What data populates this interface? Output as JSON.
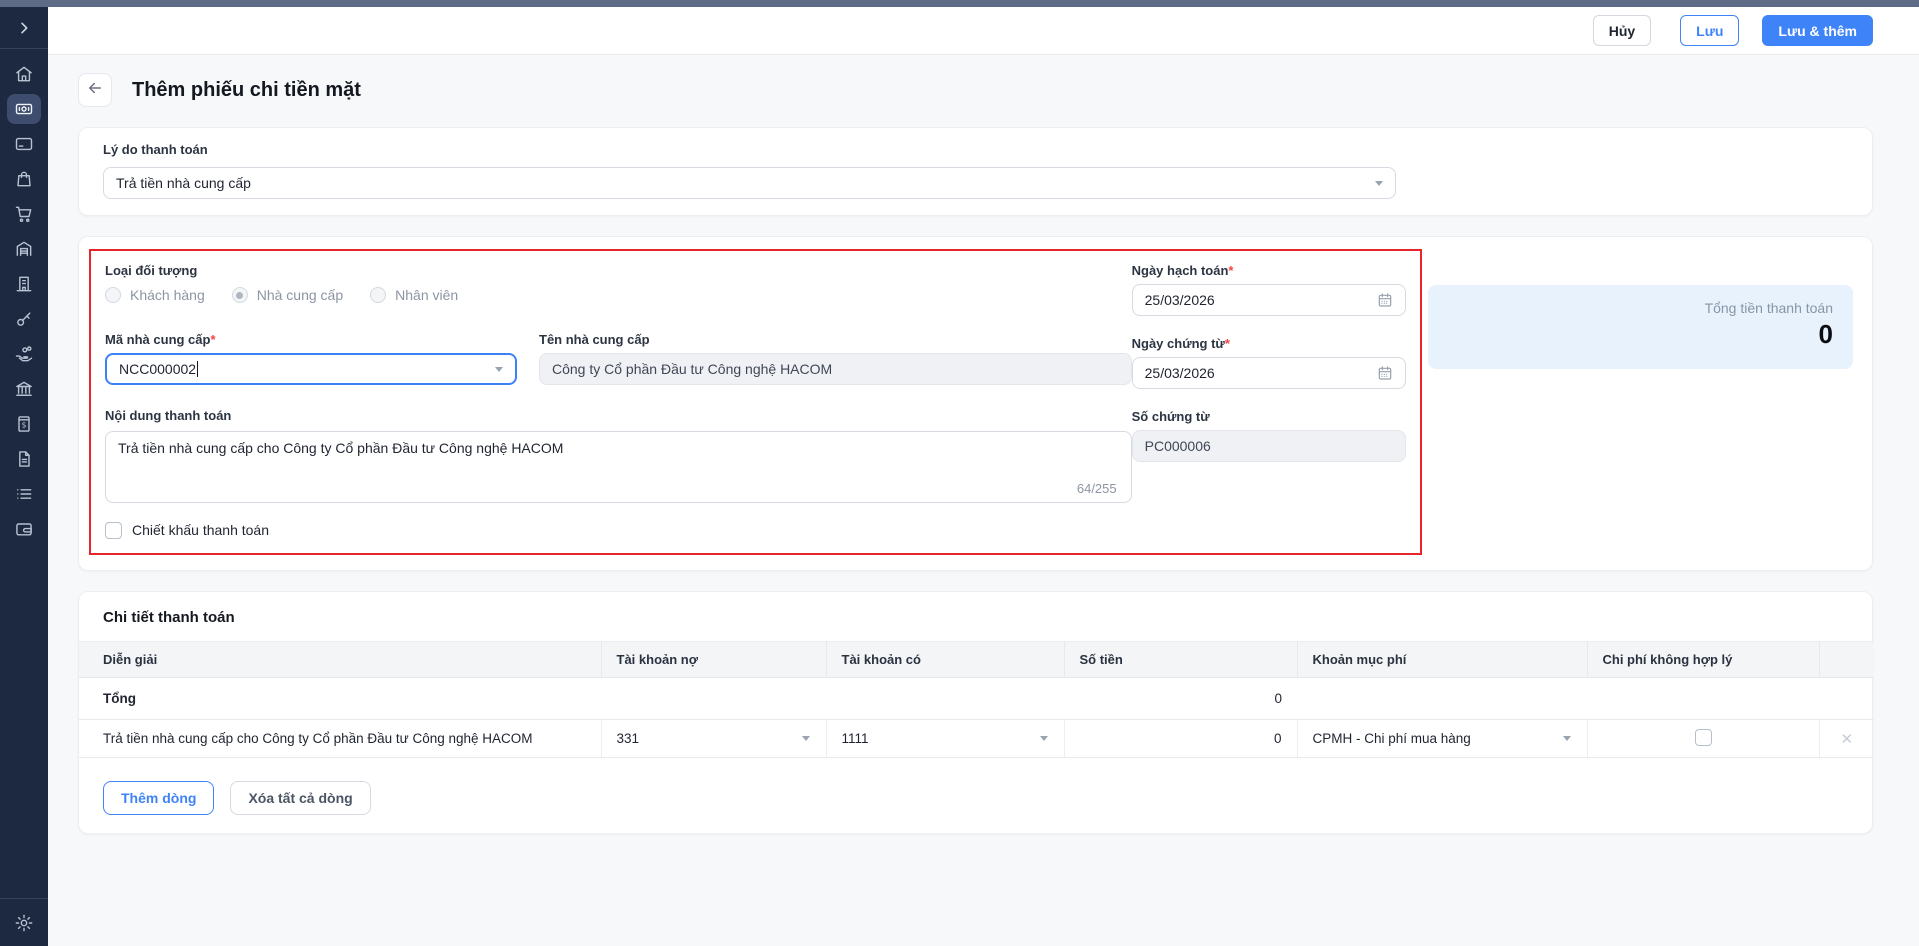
{
  "topbar": {
    "cancel": "Hủy",
    "save": "Lưu",
    "save_and_add": "Lưu & thêm"
  },
  "header": {
    "title": "Thêm phiếu chi tiền mặt"
  },
  "reason_card": {
    "label": "Lý do thanh toán",
    "value": "Trả tiền nhà cung cấp"
  },
  "info_card": {
    "object_type": {
      "label": "Loại đối tượng",
      "options": [
        {
          "label": "Khách hàng",
          "selected": false
        },
        {
          "label": "Nhà cung cấp",
          "selected": true
        },
        {
          "label": "Nhân viên",
          "selected": false
        }
      ]
    },
    "supplier_code": {
      "label": "Mã nhà cung cấp",
      "required": "*",
      "value": "NCC000002"
    },
    "supplier_name": {
      "label": "Tên nhà cung cấp",
      "value": "Công ty Cổ phần Đầu tư Công nghệ HACOM"
    },
    "payment_content": {
      "label": "Nội dung thanh toán",
      "value": "Trả tiền nhà cung cấp cho Công ty Cổ phần Đầu tư Công nghệ HACOM",
      "counter": "64/255"
    },
    "discount_checkbox_label": "Chiết khấu thanh toán",
    "posting_date": {
      "label": "Ngày hạch toán",
      "required": "*",
      "value": "25/03/2026"
    },
    "document_date": {
      "label": "Ngày chứng từ",
      "required": "*",
      "value": "25/03/2026"
    },
    "document_number": {
      "label": "Số chứng từ",
      "value": "PC000006"
    },
    "total_panel": {
      "label": "Tổng tiền thanh toán",
      "value": "0"
    }
  },
  "detail_card": {
    "title": "Chi tiết thanh toán",
    "columns": [
      "Diễn giải",
      "Tài khoản nợ",
      "Tài khoản có",
      "Số tiền",
      "Khoản mục phí",
      "Chi phí không hợp lý"
    ],
    "total_row": {
      "label": "Tổng",
      "amount": "0"
    },
    "rows": [
      {
        "description": "Trả tiền nhà cung cấp cho Công ty Cổ phần Đầu tư Công nghệ HACOM",
        "debit_account": "331",
        "credit_account": "1111",
        "amount": "0",
        "expense_item": "CPMH - Chi phí mua hàng",
        "invalid_expense_checked": false,
        "delete_label": "✕"
      }
    ],
    "add_row_label": "Thêm dòng",
    "delete_all_label": "Xóa tất cả dòng"
  },
  "sidebar": {
    "items": [
      {
        "icon": "home"
      },
      {
        "icon": "cash"
      },
      {
        "icon": "credit-card"
      },
      {
        "icon": "shopping-bag"
      },
      {
        "icon": "shopping-cart"
      },
      {
        "icon": "warehouse"
      },
      {
        "icon": "building"
      },
      {
        "icon": "key"
      },
      {
        "icon": "hand-coins"
      },
      {
        "icon": "bank"
      },
      {
        "icon": "invoice-dollar"
      },
      {
        "icon": "document"
      },
      {
        "icon": "list"
      },
      {
        "icon": "wallet"
      }
    ],
    "active_icon": "cash"
  },
  "colors": {
    "accent_blue": "#3f83f8",
    "highlight_red": "#e8252a",
    "sidebar_bg": "#1d2940",
    "total_panel_bg": "#e7f2fc"
  }
}
